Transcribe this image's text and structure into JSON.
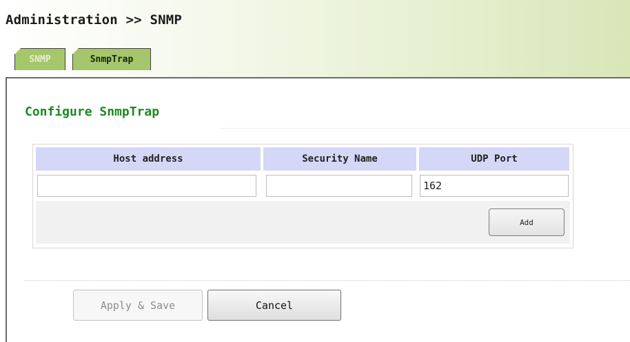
{
  "header": {
    "title": "Administration >> SNMP"
  },
  "tabs": [
    {
      "label": "SNMP",
      "active": false
    },
    {
      "label": "SnmpTrap",
      "active": true
    }
  ],
  "section": {
    "title": "Configure SnmpTrap"
  },
  "table": {
    "columns": [
      "Host address",
      "Security Name",
      "UDP Port"
    ],
    "inputs": {
      "host_address": "",
      "security_name": "",
      "udp_port": "162"
    },
    "add_label": "Add"
  },
  "footer": {
    "apply_label": "Apply & Save",
    "cancel_label": "Cancel"
  },
  "colors": {
    "tab_green": "#a6c66c",
    "section_title_green": "#1a8a20",
    "table_header": "#d4d7f6"
  }
}
